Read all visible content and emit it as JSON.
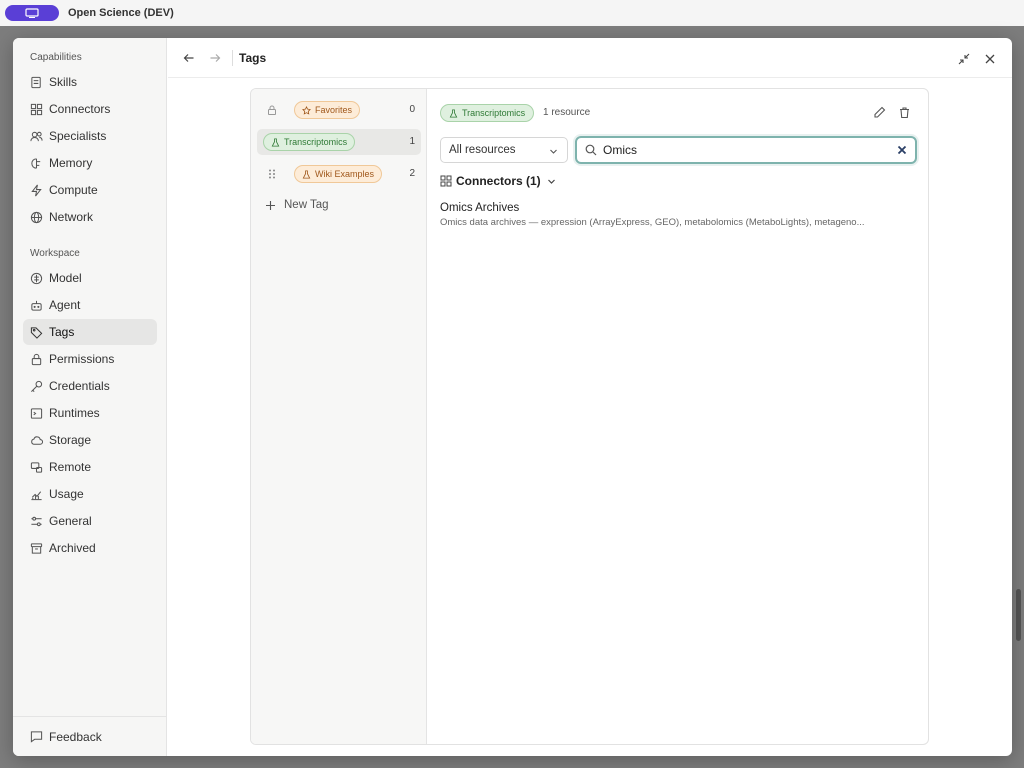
{
  "app": {
    "title": "Open Science (DEV)",
    "accent": "#5a3fd6"
  },
  "sidebar": {
    "capabilities_label": "Capabilities",
    "capabilities": [
      {
        "label": "Skills",
        "icon": "skills-icon"
      },
      {
        "label": "Connectors",
        "icon": "connectors-icon"
      },
      {
        "label": "Specialists",
        "icon": "specialists-icon"
      },
      {
        "label": "Memory",
        "icon": "memory-icon"
      },
      {
        "label": "Compute",
        "icon": "compute-icon"
      },
      {
        "label": "Network",
        "icon": "globe-icon"
      }
    ],
    "workspace_label": "Workspace",
    "workspace": [
      {
        "label": "Model",
        "icon": "model-icon"
      },
      {
        "label": "Agent",
        "icon": "agent-icon"
      },
      {
        "label": "Tags",
        "icon": "tags-icon",
        "active": true
      },
      {
        "label": "Permissions",
        "icon": "lock-icon"
      },
      {
        "label": "Credentials",
        "icon": "key-icon"
      },
      {
        "label": "Runtimes",
        "icon": "terminal-icon"
      },
      {
        "label": "Storage",
        "icon": "cloud-icon"
      },
      {
        "label": "Remote",
        "icon": "remote-icon"
      },
      {
        "label": "Usage",
        "icon": "usage-chart-icon"
      },
      {
        "label": "General",
        "icon": "sliders-icon"
      },
      {
        "label": "Archived",
        "icon": "archive-icon"
      }
    ],
    "feedback_label": "Feedback"
  },
  "header": {
    "title": "Tags"
  },
  "tags": [
    {
      "label": "Favorites",
      "count": "0",
      "style": "orange",
      "icon": "star-icon",
      "locked": true
    },
    {
      "label": "Transcriptomics",
      "count": "1",
      "style": "green",
      "icon": "flask-icon",
      "selected": true
    },
    {
      "label": "Wiki Examples",
      "count": "2",
      "style": "orange",
      "icon": "flask-icon"
    }
  ],
  "new_tag_label": "New Tag",
  "detail": {
    "tag_label": "Transcriptomics",
    "resource_count": "1 resource",
    "filter_value": "All resources",
    "search_value": "Omics",
    "group_label": "Connectors (1)",
    "results": [
      {
        "title": "Omics Archives",
        "description": "Omics data archives — expression (ArrayExpress, GEO), metabolomics (MetaboLights), metageno..."
      }
    ]
  },
  "colors": {
    "green_chip_bg": "#dff0df",
    "orange_chip_bg": "#fdecd8",
    "search_focus": "#7eb3ad"
  }
}
